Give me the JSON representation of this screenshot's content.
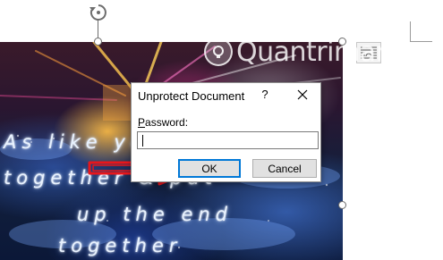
{
  "watermark": {
    "text": "Quantrimang"
  },
  "lyrics": {
    "line1": "As like you",
    "line2": "together & put",
    "line3": "up the end",
    "line4": "together"
  },
  "dialog": {
    "title": "Unprotect Document",
    "help_label": "?",
    "password_label_mnemonic": "P",
    "password_label_rest": "assword:",
    "password_value": "",
    "ok_label": "OK",
    "cancel_label": "Cancel"
  },
  "colors": {
    "arrow": "#e8161b",
    "ok_focus_border": "#0078d7"
  }
}
